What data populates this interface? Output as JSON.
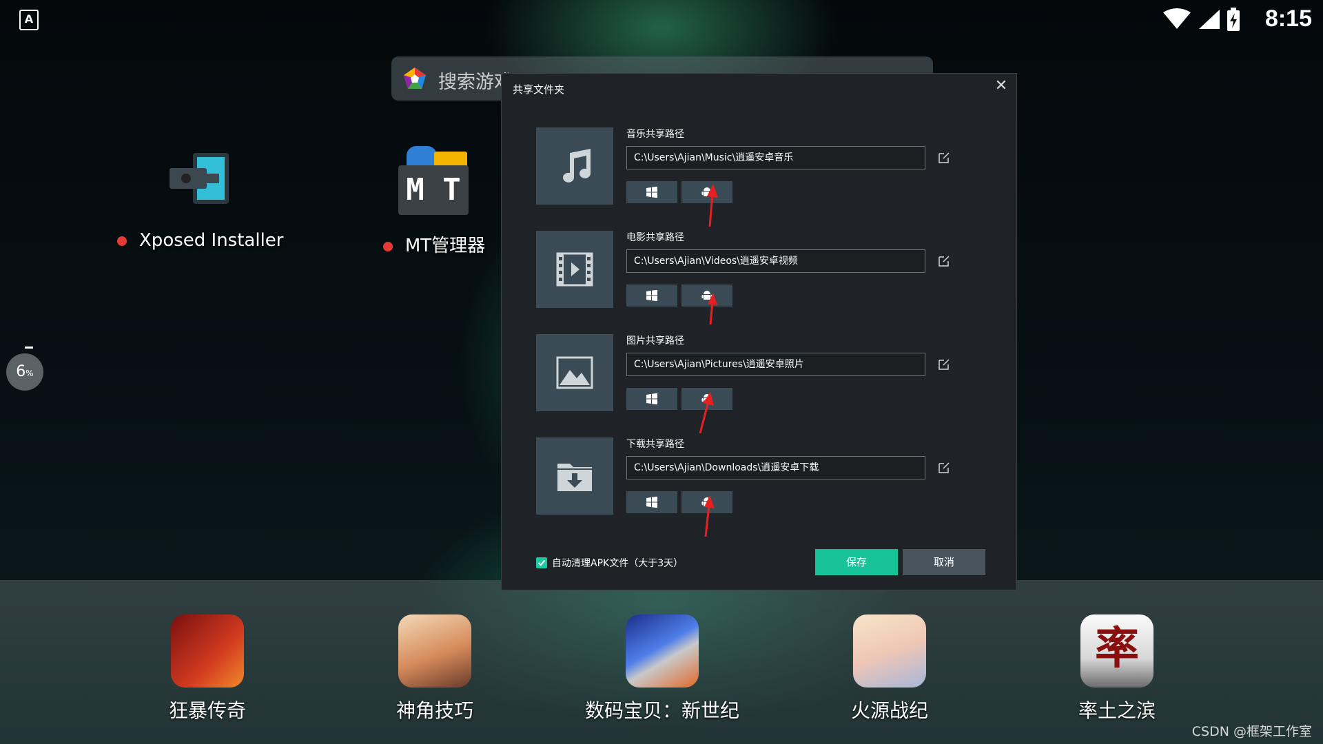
{
  "status_bar": {
    "time": "8:15",
    "left_icon": "A"
  },
  "search": {
    "placeholder": "搜索游戏"
  },
  "desktop_apps": [
    {
      "label": "Xposed Installer",
      "icon": "puzzle-icon"
    },
    {
      "label": "MT管理器",
      "icon": "mt-icon",
      "icon_text": "M T"
    }
  ],
  "progress": {
    "value": "6",
    "unit": "%"
  },
  "dialog": {
    "title": "共享文件夹",
    "sections": [
      {
        "label": "音乐共享路径",
        "path": "C:\\Users\\Ajian\\Music\\逍遥安卓音乐",
        "icon": "music-note-icon"
      },
      {
        "label": "电影共享路径",
        "path": "C:\\Users\\Ajian\\Videos\\逍遥安卓视频",
        "icon": "film-icon"
      },
      {
        "label": "图片共享路径",
        "path": "C:\\Users\\Ajian\\Pictures\\逍遥安卓照片",
        "icon": "picture-icon"
      },
      {
        "label": "下载共享路径",
        "path": "C:\\Users\\Ajian\\Downloads\\逍遥安卓下载",
        "icon": "download-folder-icon"
      }
    ],
    "auto_clean": {
      "label": "自动清理APK文件（大于3天）",
      "checked": true
    },
    "save_label": "保存",
    "cancel_label": "取消"
  },
  "dock": [
    {
      "label": "狂暴传奇",
      "color": "#b3261e"
    },
    {
      "label": "神角技巧",
      "color": "#c9886a"
    },
    {
      "label": "数码宝贝：新世纪",
      "color": "#3a5bd1"
    },
    {
      "label": "火源战纪",
      "color": "#e8c7b0"
    },
    {
      "label": "率土之滨",
      "color": "#e9e9e9"
    }
  ],
  "watermark": "CSDN @框架工作室",
  "colors": {
    "accent": "#18c39a",
    "panel": "#1f2327",
    "tile": "#3a4b55"
  }
}
